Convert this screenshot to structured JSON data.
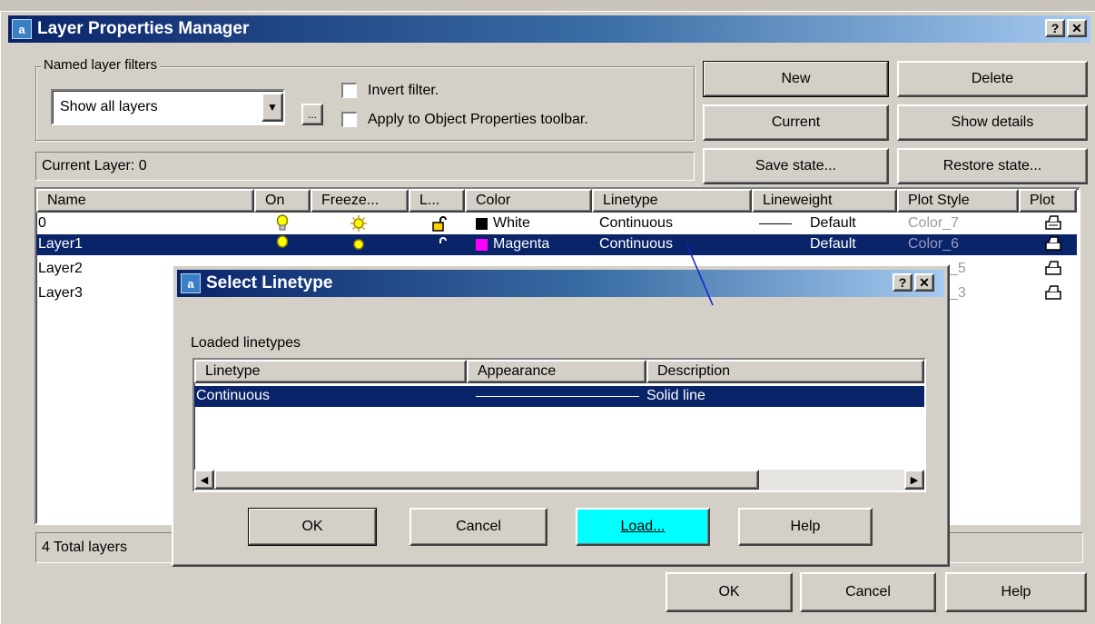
{
  "main_window": {
    "title": "Layer Properties Manager",
    "help_glyph": "?",
    "close_glyph": "✕",
    "filters": {
      "legend": "Named layer filters",
      "selected": "Show all layers",
      "browse_label": "...",
      "invert_label": "Invert filter.",
      "apply_label": "Apply to Object Properties toolbar."
    },
    "buttons": {
      "new": "New",
      "delete": "Delete",
      "current": "Current",
      "show_details": "Show details",
      "save_state": "Save state...",
      "restore_state": "Restore state..."
    },
    "current_layer": "Current Layer:  0",
    "columns": [
      "Name",
      "On",
      "Freeze...",
      "L...",
      "Color",
      "Linetype",
      "Lineweight",
      "Plot Style",
      "Plot"
    ],
    "layers": [
      {
        "name": "0",
        "color": "White",
        "color_hex": "#000000",
        "linetype": "Continuous",
        "lineweight": "Default",
        "plot_style": "Color_7",
        "selected": false
      },
      {
        "name": "Layer1",
        "color": "Magenta",
        "color_hex": "#ff00ff",
        "linetype": "Continuous",
        "lineweight": "Default",
        "plot_style": "Color_6",
        "selected": true
      },
      {
        "name": "Layer2",
        "plot_style": "_5",
        "selected": false
      },
      {
        "name": "Layer3",
        "plot_style": "_3",
        "selected": false
      }
    ],
    "status": "4 Total layers",
    "ok": "OK",
    "cancel": "Cancel",
    "help": "Help"
  },
  "dialog": {
    "title": "Select Linetype",
    "help_glyph": "?",
    "close_glyph": "✕",
    "section_label": "Loaded linetypes",
    "columns": [
      "Linetype",
      "Appearance",
      "Description"
    ],
    "rows": [
      {
        "linetype": "Continuous",
        "description": "Solid line"
      }
    ],
    "ok": "OK",
    "cancel": "Cancel",
    "load": "Load...",
    "help": "Help"
  },
  "colors": {
    "title_active": "#0a246a",
    "selection": "#0a246a",
    "load_button": "#00ffff",
    "face": "#d4d0c8"
  }
}
